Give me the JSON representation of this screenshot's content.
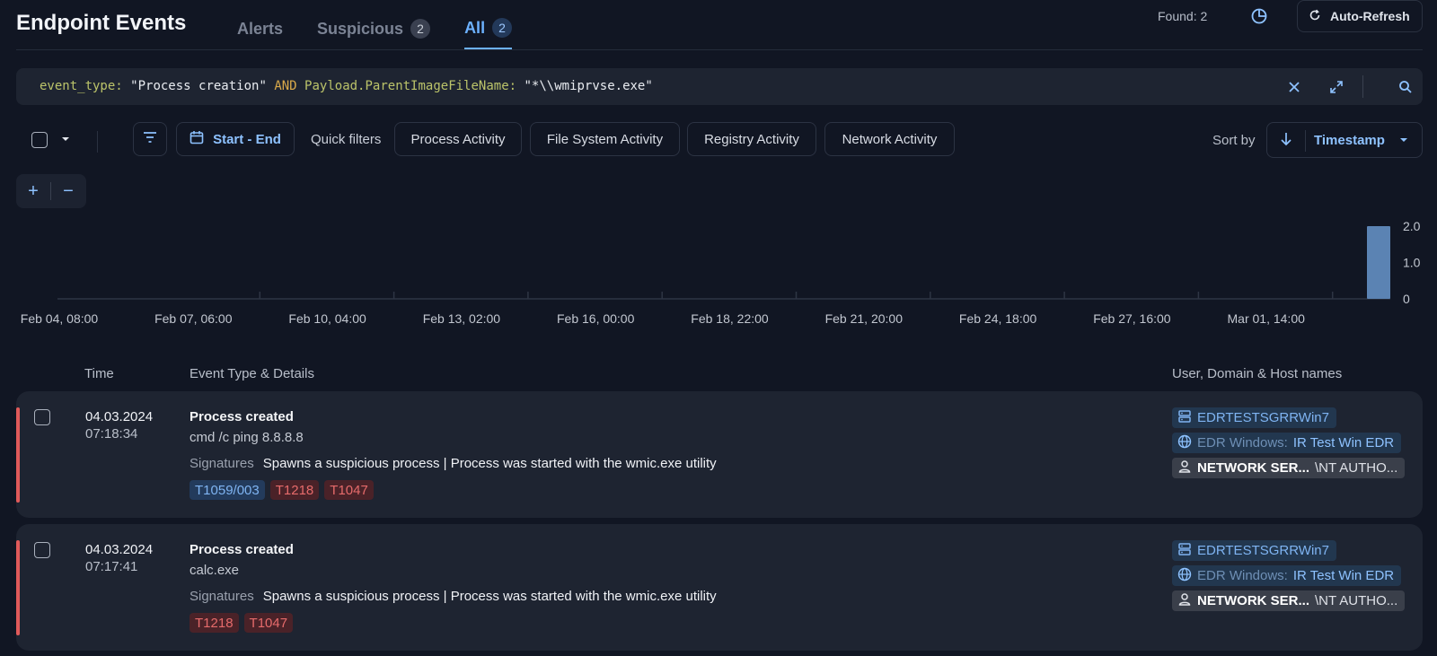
{
  "header": {
    "title": "Endpoint Events",
    "tabs": [
      {
        "label": "Alerts"
      },
      {
        "label": "Suspicious",
        "badge": "2"
      },
      {
        "label": "All",
        "badge": "2"
      }
    ],
    "found": "Found: 2",
    "auto_refresh": "Auto-Refresh"
  },
  "query": {
    "field1": "event_type:",
    "value1": "\"Process creation\"",
    "op": "AND",
    "field2": "Payload.ParentImageFileName:",
    "value2": "\"*\\\\wmiprvse.exe\""
  },
  "toolbar": {
    "date_range": "Start - End",
    "quick_filters_label": "Quick filters",
    "quick_filters": [
      "Process Activity",
      "File System Activity",
      "Registry Activity",
      "Network Activity"
    ],
    "sort_label": "Sort by",
    "sort_value": "Timestamp"
  },
  "zoom": {
    "plus": "+",
    "minus": "−"
  },
  "chart_data": {
    "type": "bar",
    "x_tick_labels": [
      "Feb 04, 08:00",
      "Feb 07, 06:00",
      "Feb 10, 04:00",
      "Feb 13, 02:00",
      "Feb 16, 00:00",
      "Feb 18, 22:00",
      "Feb 21, 20:00",
      "Feb 24, 18:00",
      "Feb 27, 16:00",
      "Mar 01, 14:00"
    ],
    "y_tick_labels": [
      "2.0",
      "1.0",
      "0"
    ],
    "ylim": [
      0,
      2
    ],
    "bars": [
      {
        "x": "04.03.2024",
        "value": 2
      }
    ],
    "grid": false
  },
  "table": {
    "columns": {
      "time": "Time",
      "event": "Event Type & Details",
      "user": "User, Domain & Host names"
    },
    "signatures_label": "Signatures",
    "rows": [
      {
        "date": "04.03.2024",
        "time": "07:18:34",
        "event_type": "Process created",
        "command": "cmd /c ping 8.8.8.8",
        "signatures": "Spawns a suspicious process | Process was started with the wmic.exe utility",
        "tags": [
          {
            "label": "T1059/003",
            "color": "blue"
          },
          {
            "label": "T1218",
            "color": "red"
          },
          {
            "label": "T1047",
            "color": "red"
          }
        ],
        "host": "EDRTESTSGRRWin7",
        "domain_prefix": "EDR Windows:",
        "domain_name": "IR Test Win EDR",
        "user_name": "NETWORK SER...",
        "user_domain": "\\NT AUTHO..."
      },
      {
        "date": "04.03.2024",
        "time": "07:17:41",
        "event_type": "Process created",
        "command": "calc.exe",
        "signatures": "Spawns a suspicious process | Process was started with the wmic.exe utility",
        "tags": [
          {
            "label": "T1218",
            "color": "red"
          },
          {
            "label": "T1047",
            "color": "red"
          }
        ],
        "host": "EDRTESTSGRRWin7",
        "domain_prefix": "EDR Windows:",
        "domain_name": "IR Test Win EDR",
        "user_name": "NETWORK SER...",
        "user_domain": "\\NT AUTHO..."
      }
    ]
  }
}
